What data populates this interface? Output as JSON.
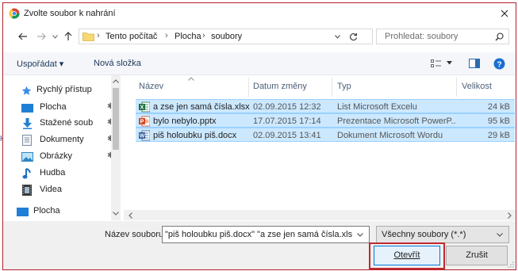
{
  "window": {
    "title": "Zvolte soubor k nahrání"
  },
  "nav": {
    "breadcrumb": [
      "Tento počítač",
      "Plocha",
      "soubory"
    ],
    "search_placeholder": "Prohledat: soubory"
  },
  "toolbar": {
    "organize_label": "Uspořádat ▾",
    "new_folder_label": "Nová složka"
  },
  "sidebar": {
    "items": [
      {
        "label": "Rychlý přístup",
        "icon": "star-icon"
      },
      {
        "label": "Plocha",
        "icon": "desktop-icon"
      },
      {
        "label": "Stažené soub",
        "icon": "download-icon"
      },
      {
        "label": "Dokumenty",
        "icon": "documents-icon"
      },
      {
        "label": "Obrázky",
        "icon": "pictures-icon"
      },
      {
        "label": "Hudba",
        "icon": "music-icon"
      },
      {
        "label": "Videa",
        "icon": "video-icon"
      },
      {
        "label": "Plocha",
        "icon": "desktop-icon"
      }
    ]
  },
  "columns": {
    "name": "Název",
    "date": "Datum změny",
    "type": "Typ",
    "size": "Velikost"
  },
  "files": [
    {
      "name": "a zse jen samá čísla.xlsx",
      "date": "02.09.2015 12:32",
      "type": "List Microsoft Excelu",
      "size": "24 kB",
      "icon": "excel-file-icon",
      "color": "#1e7145"
    },
    {
      "name": "bylo nebylo.pptx",
      "date": "17.07.2015 17:14",
      "type": "Prezentace Microsoft PowerP...",
      "size": "95 kB",
      "icon": "powerpoint-file-icon",
      "color": "#d24726"
    },
    {
      "name": "piš holoubku piš.docx",
      "date": "02.09.2015 13:41",
      "type": "Dokument Microsoft Wordu",
      "size": "29 kB",
      "icon": "word-file-icon",
      "color": "#2b579a"
    }
  ],
  "footer": {
    "filename_label": "Název souboru:",
    "filename_value": "\"piš holoubku piš.docx\" \"a zse jen samá čísla.xlsx\" \"",
    "filetype_value": "Všechny soubory (*.*)",
    "open_label": "Otevřít",
    "cancel_label": "Zrušit"
  },
  "colors": {
    "accent": "#0078d7",
    "selection": "#cce8ff",
    "highlight_border": "#c0282e",
    "frame_border": "#b3202b"
  }
}
